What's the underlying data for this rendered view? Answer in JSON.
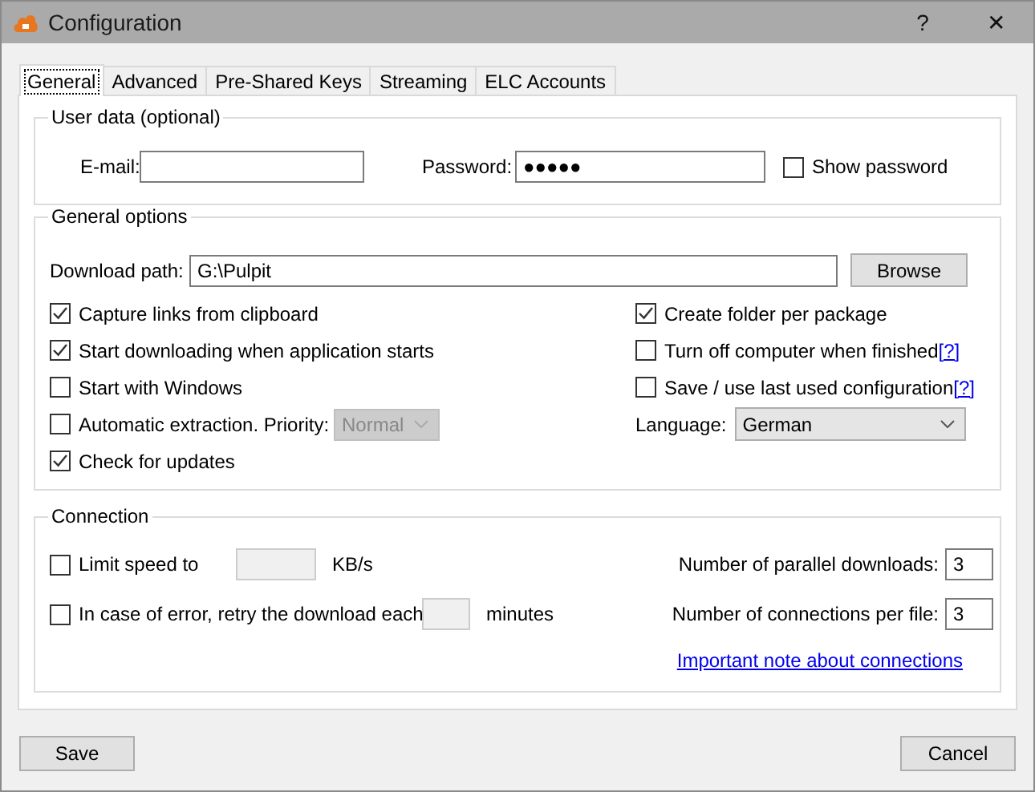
{
  "window": {
    "title": "Configuration",
    "help_button": "?",
    "close_button": "✕"
  },
  "tabs": [
    {
      "label": "General",
      "selected": true
    },
    {
      "label": "Advanced",
      "selected": false
    },
    {
      "label": "Pre-Shared Keys",
      "selected": false
    },
    {
      "label": "Streaming",
      "selected": false
    },
    {
      "label": "ELC Accounts",
      "selected": false
    }
  ],
  "user_data": {
    "title": "User data (optional)",
    "email_label": "E-mail:",
    "password_label": "Password:",
    "password_value": "●●●●●",
    "show_password": {
      "label": "Show password",
      "checked": false
    }
  },
  "general_options": {
    "title": "General options",
    "download_path_label": "Download path:",
    "download_path_value": "G:\\Pulpit",
    "browse_button": "Browse",
    "left_options": [
      {
        "label": "Capture links from clipboard",
        "checked": true
      },
      {
        "label": "Start downloading when application starts",
        "checked": true
      },
      {
        "label": "Start with Windows",
        "checked": false
      },
      {
        "label": "Automatic extraction. Priority:",
        "checked": false,
        "priority": {
          "value": "Normal",
          "disabled": true
        }
      },
      {
        "label": "Check for updates",
        "checked": true
      }
    ],
    "right_options": [
      {
        "label": "Create folder per package",
        "checked": true
      },
      {
        "label": "Turn off computer when finished",
        "checked": false,
        "help_link": "[?]"
      },
      {
        "label": "Save / use last used configuration",
        "checked": false,
        "help_link": "[?]"
      }
    ],
    "language": {
      "label": "Language:",
      "value": "German"
    }
  },
  "connection": {
    "title": "Connection",
    "left_rows": [
      {
        "label": "Limit speed to",
        "checked": false,
        "field_disabled": true,
        "unit": "KB/s"
      },
      {
        "label": "In case of error, retry the download each",
        "checked": false,
        "field_disabled": true,
        "unit": "minutes"
      }
    ],
    "right_rows": [
      {
        "label": "Number of parallel downloads:",
        "value": "3"
      },
      {
        "label": "Number of connections per file:",
        "value": "3"
      }
    ],
    "note_link": "Important note about connections"
  },
  "buttons": {
    "save": "Save",
    "cancel": "Cancel"
  }
}
